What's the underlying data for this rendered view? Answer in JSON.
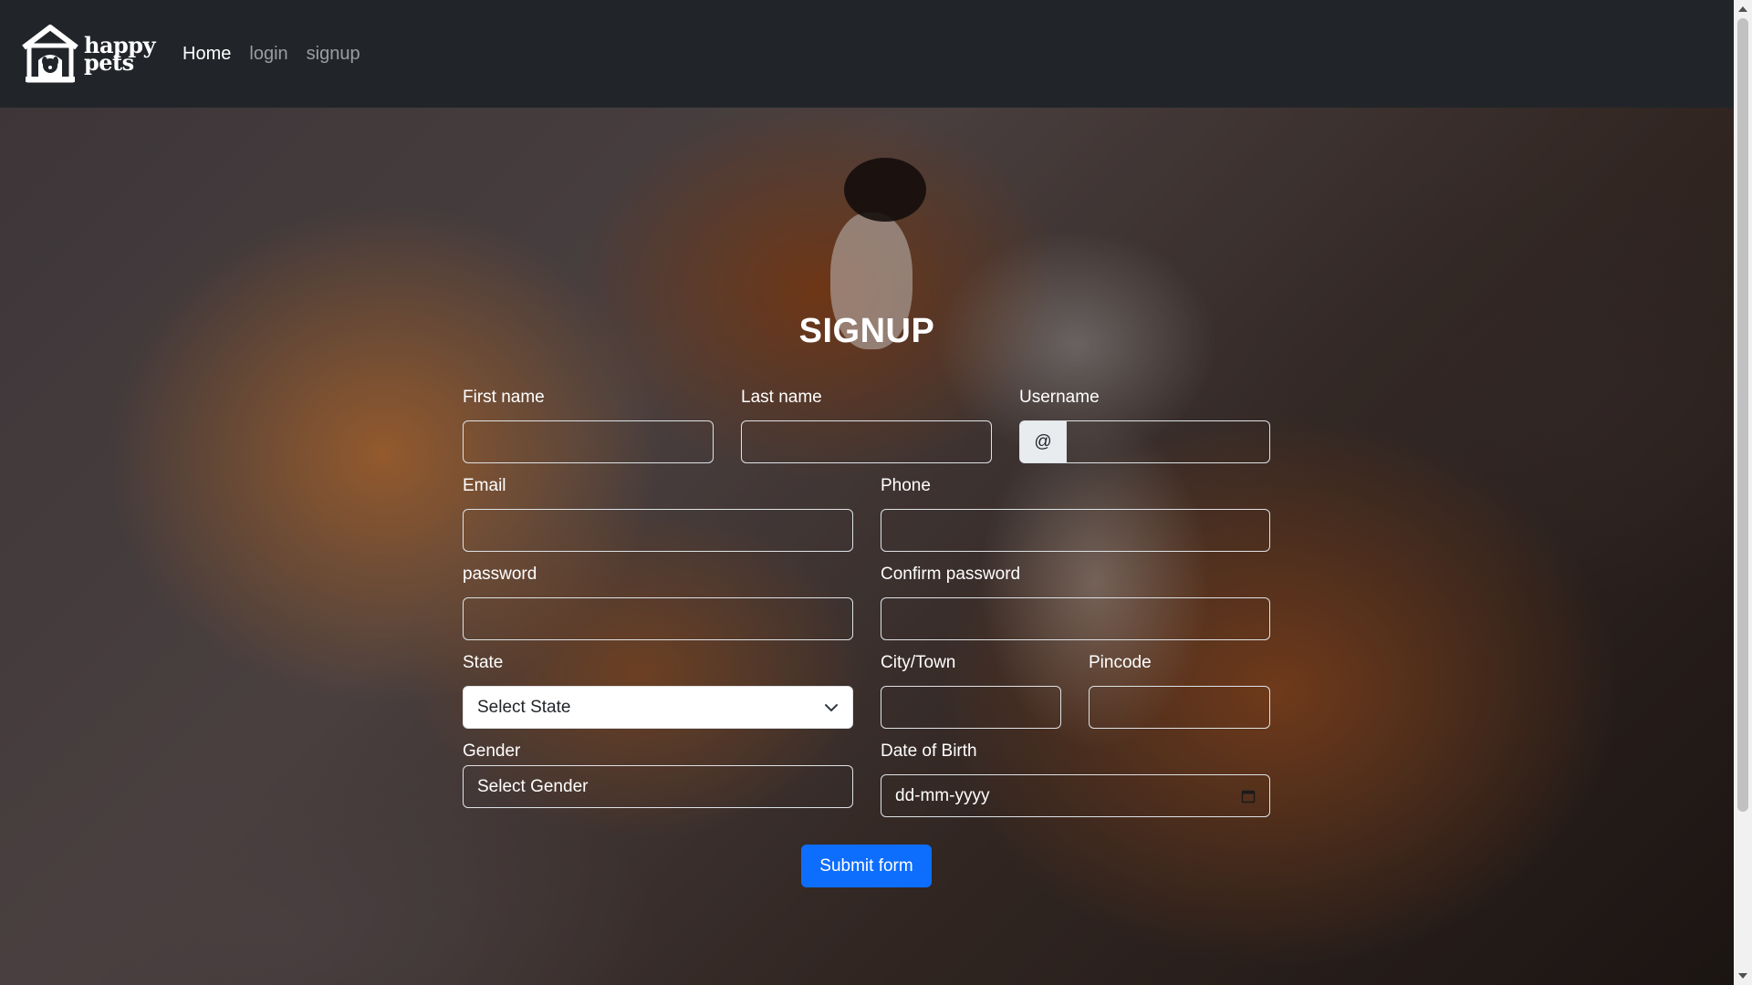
{
  "navbar": {
    "brand": {
      "line1": "happy",
      "line2": "pets"
    },
    "links": [
      {
        "label": "Home",
        "active": true
      },
      {
        "label": "login",
        "active": false
      },
      {
        "label": "signup",
        "active": false
      }
    ]
  },
  "form": {
    "title": "SIGNUP",
    "first_name_label": "First name",
    "last_name_label": "Last name",
    "username_label": "Username",
    "username_prefix": "@",
    "email_label": "Email",
    "phone_label": "Phone",
    "password_label": "password",
    "confirm_password_label": "Confirm password",
    "state_label": "State",
    "state_selected": "Select State",
    "city_label": "City/Town",
    "pincode_label": "Pincode",
    "gender_label": "Gender",
    "gender_selected": "Select Gender",
    "dob_label": "Date of Birth",
    "dob_placeholder": "dd-mm-yyyy",
    "submit_label": "Submit form"
  },
  "colors": {
    "navbar_bg": "#212529",
    "primary": "#0d6efd"
  }
}
